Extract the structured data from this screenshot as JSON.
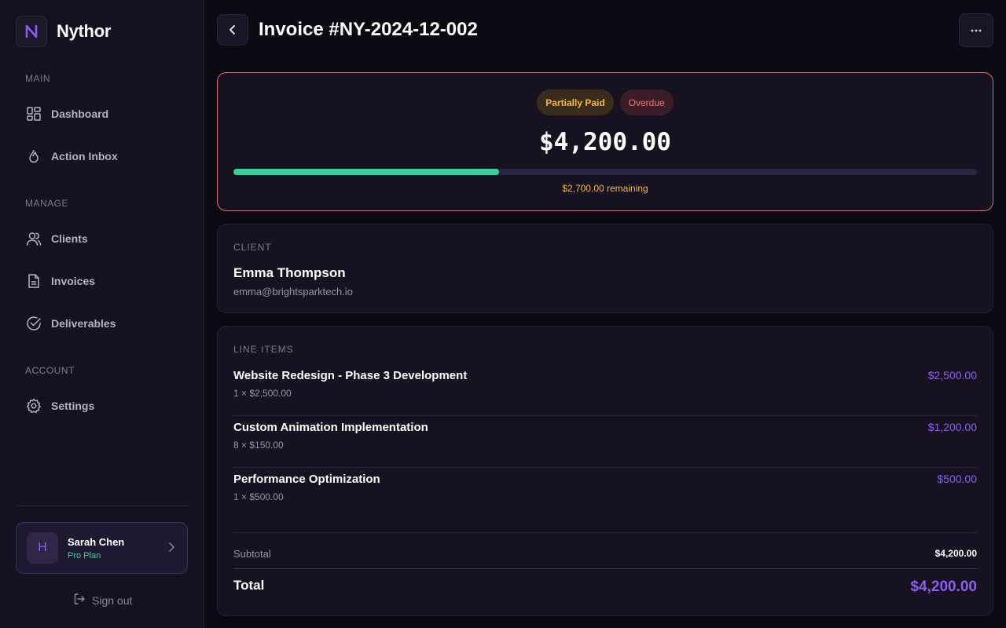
{
  "app": {
    "brand_letter": "N",
    "brand_name": "Nythor",
    "accent_color": "#8b5cf6"
  },
  "sidebar": {
    "sections": [
      {
        "label": "MAIN",
        "items": [
          {
            "label": "Dashboard",
            "icon": "grid-icon"
          },
          {
            "label": "Action Inbox",
            "icon": "flame-icon"
          }
        ]
      },
      {
        "label": "MANAGE",
        "items": [
          {
            "label": "Clients",
            "icon": "users-icon"
          },
          {
            "label": "Invoices",
            "icon": "document-icon"
          },
          {
            "label": "Deliverables",
            "icon": "check-circle-icon"
          }
        ]
      },
      {
        "label": "ACCOUNT",
        "items": [
          {
            "label": "Settings",
            "icon": "gear-icon"
          }
        ]
      }
    ],
    "user": {
      "initial": "H",
      "name": "Sarah Chen",
      "plan": "Pro Plan"
    },
    "sign_out_label": "Sign out"
  },
  "header": {
    "title": "Invoice #NY-2024-12-002"
  },
  "summary": {
    "status_badge": "Partially Paid",
    "overdue_badge": "Overdue",
    "amount": "$4,200.00",
    "paid_fraction": 0.357,
    "remaining": "$2,700.00 remaining",
    "status_color": "#f5b942",
    "overdue_color": "#f47272",
    "progress_color": "#34d399"
  },
  "client": {
    "section_label": "CLIENT",
    "name": "Emma Thompson",
    "email": "emma@brightsparktech.io"
  },
  "line_items": {
    "section_label": "LINE ITEMS",
    "items": [
      {
        "name": "Website Redesign - Phase 3 Development",
        "qty": "1 × $2,500.00",
        "price": "$2,500.00"
      },
      {
        "name": "Custom Animation Implementation",
        "qty": "8 × $150.00",
        "price": "$1,200.00"
      },
      {
        "name": "Performance Optimization",
        "qty": "1 × $500.00",
        "price": "$500.00"
      }
    ],
    "subtotal_label": "Subtotal",
    "subtotal_value": "$4,200.00",
    "total_label": "Total",
    "total_value": "$4,200.00"
  }
}
